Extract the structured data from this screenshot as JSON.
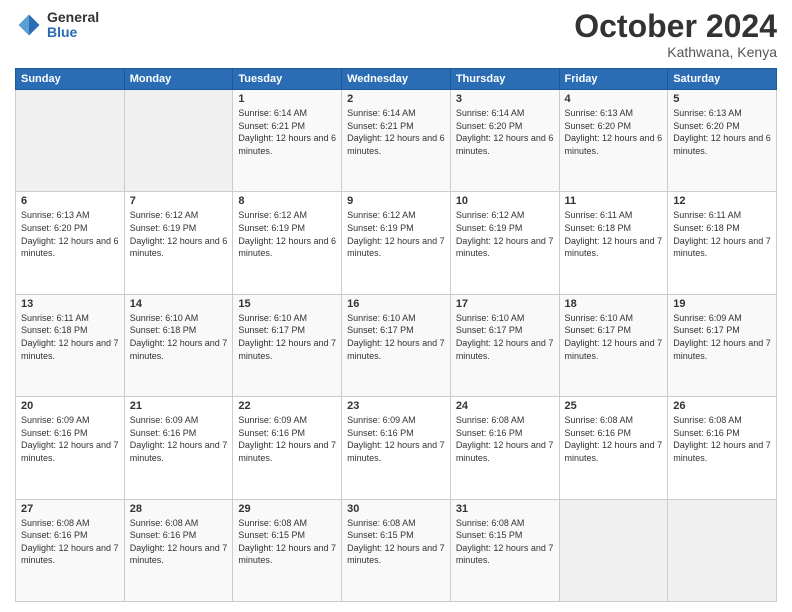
{
  "logo": {
    "general": "General",
    "blue": "Blue"
  },
  "header": {
    "month": "October 2024",
    "location": "Kathwana, Kenya"
  },
  "weekdays": [
    "Sunday",
    "Monday",
    "Tuesday",
    "Wednesday",
    "Thursday",
    "Friday",
    "Saturday"
  ],
  "weeks": [
    [
      null,
      null,
      {
        "day": "1",
        "sunrise": "Sunrise: 6:14 AM",
        "sunset": "Sunset: 6:21 PM",
        "daylight": "Daylight: 12 hours and 6 minutes."
      },
      {
        "day": "2",
        "sunrise": "Sunrise: 6:14 AM",
        "sunset": "Sunset: 6:21 PM",
        "daylight": "Daylight: 12 hours and 6 minutes."
      },
      {
        "day": "3",
        "sunrise": "Sunrise: 6:14 AM",
        "sunset": "Sunset: 6:20 PM",
        "daylight": "Daylight: 12 hours and 6 minutes."
      },
      {
        "day": "4",
        "sunrise": "Sunrise: 6:13 AM",
        "sunset": "Sunset: 6:20 PM",
        "daylight": "Daylight: 12 hours and 6 minutes."
      },
      {
        "day": "5",
        "sunrise": "Sunrise: 6:13 AM",
        "sunset": "Sunset: 6:20 PM",
        "daylight": "Daylight: 12 hours and 6 minutes."
      }
    ],
    [
      {
        "day": "6",
        "sunrise": "Sunrise: 6:13 AM",
        "sunset": "Sunset: 6:20 PM",
        "daylight": "Daylight: 12 hours and 6 minutes."
      },
      {
        "day": "7",
        "sunrise": "Sunrise: 6:12 AM",
        "sunset": "Sunset: 6:19 PM",
        "daylight": "Daylight: 12 hours and 6 minutes."
      },
      {
        "day": "8",
        "sunrise": "Sunrise: 6:12 AM",
        "sunset": "Sunset: 6:19 PM",
        "daylight": "Daylight: 12 hours and 6 minutes."
      },
      {
        "day": "9",
        "sunrise": "Sunrise: 6:12 AM",
        "sunset": "Sunset: 6:19 PM",
        "daylight": "Daylight: 12 hours and 7 minutes."
      },
      {
        "day": "10",
        "sunrise": "Sunrise: 6:12 AM",
        "sunset": "Sunset: 6:19 PM",
        "daylight": "Daylight: 12 hours and 7 minutes."
      },
      {
        "day": "11",
        "sunrise": "Sunrise: 6:11 AM",
        "sunset": "Sunset: 6:18 PM",
        "daylight": "Daylight: 12 hours and 7 minutes."
      },
      {
        "day": "12",
        "sunrise": "Sunrise: 6:11 AM",
        "sunset": "Sunset: 6:18 PM",
        "daylight": "Daylight: 12 hours and 7 minutes."
      }
    ],
    [
      {
        "day": "13",
        "sunrise": "Sunrise: 6:11 AM",
        "sunset": "Sunset: 6:18 PM",
        "daylight": "Daylight: 12 hours and 7 minutes."
      },
      {
        "day": "14",
        "sunrise": "Sunrise: 6:10 AM",
        "sunset": "Sunset: 6:18 PM",
        "daylight": "Daylight: 12 hours and 7 minutes."
      },
      {
        "day": "15",
        "sunrise": "Sunrise: 6:10 AM",
        "sunset": "Sunset: 6:17 PM",
        "daylight": "Daylight: 12 hours and 7 minutes."
      },
      {
        "day": "16",
        "sunrise": "Sunrise: 6:10 AM",
        "sunset": "Sunset: 6:17 PM",
        "daylight": "Daylight: 12 hours and 7 minutes."
      },
      {
        "day": "17",
        "sunrise": "Sunrise: 6:10 AM",
        "sunset": "Sunset: 6:17 PM",
        "daylight": "Daylight: 12 hours and 7 minutes."
      },
      {
        "day": "18",
        "sunrise": "Sunrise: 6:10 AM",
        "sunset": "Sunset: 6:17 PM",
        "daylight": "Daylight: 12 hours and 7 minutes."
      },
      {
        "day": "19",
        "sunrise": "Sunrise: 6:09 AM",
        "sunset": "Sunset: 6:17 PM",
        "daylight": "Daylight: 12 hours and 7 minutes."
      }
    ],
    [
      {
        "day": "20",
        "sunrise": "Sunrise: 6:09 AM",
        "sunset": "Sunset: 6:16 PM",
        "daylight": "Daylight: 12 hours and 7 minutes."
      },
      {
        "day": "21",
        "sunrise": "Sunrise: 6:09 AM",
        "sunset": "Sunset: 6:16 PM",
        "daylight": "Daylight: 12 hours and 7 minutes."
      },
      {
        "day": "22",
        "sunrise": "Sunrise: 6:09 AM",
        "sunset": "Sunset: 6:16 PM",
        "daylight": "Daylight: 12 hours and 7 minutes."
      },
      {
        "day": "23",
        "sunrise": "Sunrise: 6:09 AM",
        "sunset": "Sunset: 6:16 PM",
        "daylight": "Daylight: 12 hours and 7 minutes."
      },
      {
        "day": "24",
        "sunrise": "Sunrise: 6:08 AM",
        "sunset": "Sunset: 6:16 PM",
        "daylight": "Daylight: 12 hours and 7 minutes."
      },
      {
        "day": "25",
        "sunrise": "Sunrise: 6:08 AM",
        "sunset": "Sunset: 6:16 PM",
        "daylight": "Daylight: 12 hours and 7 minutes."
      },
      {
        "day": "26",
        "sunrise": "Sunrise: 6:08 AM",
        "sunset": "Sunset: 6:16 PM",
        "daylight": "Daylight: 12 hours and 7 minutes."
      }
    ],
    [
      {
        "day": "27",
        "sunrise": "Sunrise: 6:08 AM",
        "sunset": "Sunset: 6:16 PM",
        "daylight": "Daylight: 12 hours and 7 minutes."
      },
      {
        "day": "28",
        "sunrise": "Sunrise: 6:08 AM",
        "sunset": "Sunset: 6:16 PM",
        "daylight": "Daylight: 12 hours and 7 minutes."
      },
      {
        "day": "29",
        "sunrise": "Sunrise: 6:08 AM",
        "sunset": "Sunset: 6:15 PM",
        "daylight": "Daylight: 12 hours and 7 minutes."
      },
      {
        "day": "30",
        "sunrise": "Sunrise: 6:08 AM",
        "sunset": "Sunset: 6:15 PM",
        "daylight": "Daylight: 12 hours and 7 minutes."
      },
      {
        "day": "31",
        "sunrise": "Sunrise: 6:08 AM",
        "sunset": "Sunset: 6:15 PM",
        "daylight": "Daylight: 12 hours and 7 minutes."
      },
      null,
      null
    ]
  ]
}
